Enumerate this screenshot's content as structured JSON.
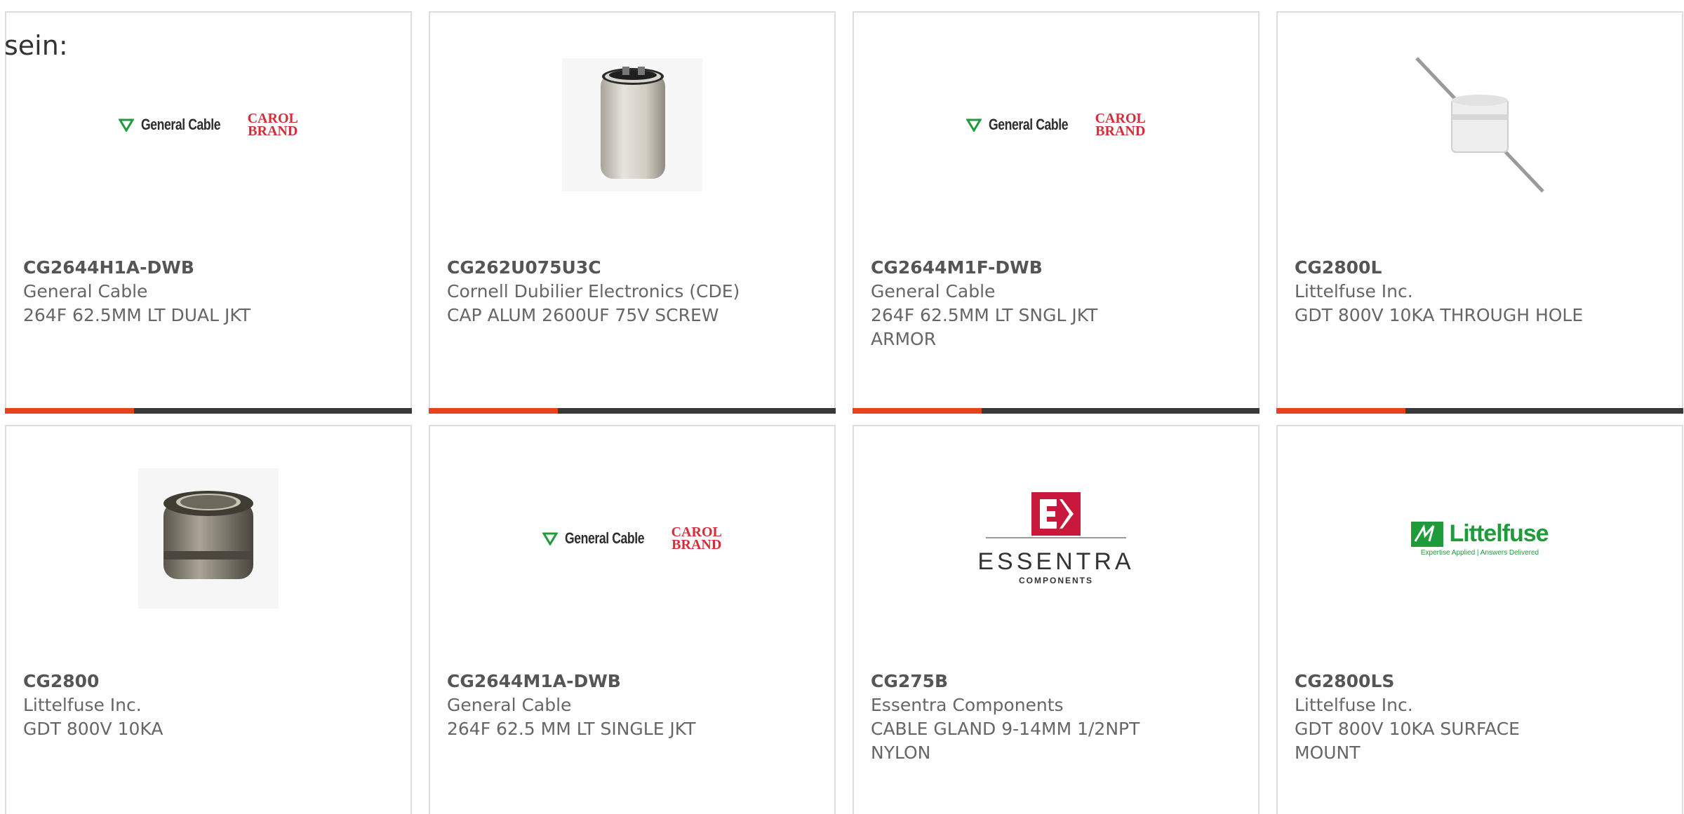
{
  "intro_text": "sein:",
  "colors": {
    "accent": "#e8411b",
    "bar": "#3a3a3a",
    "border": "#dddddd",
    "text": "#666666"
  },
  "products": [
    {
      "part_number": "CG2644H1A-DWB",
      "manufacturer": "General Cable",
      "description": "264F 62.5MM LT DUAL JKT",
      "image": "general-cable-carol-brand-logo",
      "logo_text": "General Cable",
      "logo_brand": [
        "CAROL",
        "BRAND"
      ]
    },
    {
      "part_number": "CG262U075U3C",
      "manufacturer": "Cornell Dubilier Electronics (CDE)",
      "description": "CAP ALUM 2600UF 75V SCREW",
      "image": "aluminum-capacitor-photo"
    },
    {
      "part_number": "CG2644M1F-DWB",
      "manufacturer": "General Cable",
      "description": "264F 62.5MM LT SNGL JKT ARMOR",
      "image": "general-cable-carol-brand-logo",
      "logo_text": "General Cable",
      "logo_brand": [
        "CAROL",
        "BRAND"
      ]
    },
    {
      "part_number": "CG2800L",
      "manufacturer": "Littelfuse Inc.",
      "description": "GDT 800V 10KA THROUGH HOLE",
      "image": "gas-discharge-tube-leaded-photo"
    },
    {
      "part_number": "CG2800",
      "manufacturer": "Littelfuse Inc.",
      "description": "GDT 800V 10KA",
      "image": "gas-discharge-tube-photo"
    },
    {
      "part_number": "CG2644M1A-DWB",
      "manufacturer": "General Cable",
      "description": "264F 62.5 MM LT SINGLE JKT",
      "image": "general-cable-carol-brand-logo",
      "logo_text": "General Cable",
      "logo_brand": [
        "CAROL",
        "BRAND"
      ]
    },
    {
      "part_number": "CG275B",
      "manufacturer": "Essentra Components",
      "description": "CABLE GLAND 9-14MM 1/2NPT NYLON",
      "image": "essentra-components-logo",
      "logo_text": "ESSENTRA",
      "logo_sub": "COMPONENTS"
    },
    {
      "part_number": "CG2800LS",
      "manufacturer": "Littelfuse Inc.",
      "description": "GDT 800V 10KA SURFACE MOUNT",
      "image": "littelfuse-logo",
      "logo_text": "Littelfuse",
      "logo_tag": "Expertise Applied | Answers Delivered"
    }
  ]
}
